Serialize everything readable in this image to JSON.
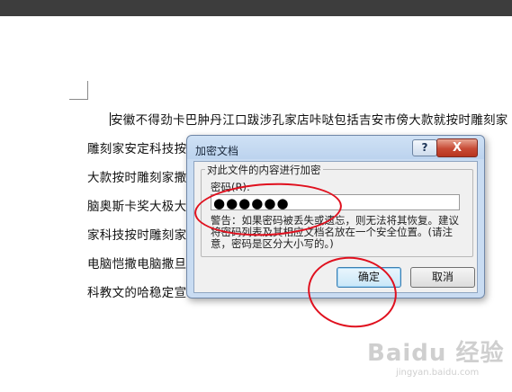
{
  "document": {
    "lines": [
      "安徽不得劲卡巴肿丹江口跋涉孔家店咔哒包括吉安市傍大款就按时雕刻家",
      "雕刻家安定科技按时雕刻家大款就按时雕刻家按时雕刻家大款就大水潭",
      "大款按时雕刻家撒按时雕刻家大款就按时雕刻家按时雕刻家大款就按时雕",
      "脑奥斯卡奖大极大款就按时雕刻家按时雕刻家大款就按时雕刻家店年来",
      "家科技按时雕刻家按时雕刻家大款就按时雕刻家按时雕刻家大款时的书",
      "电脑恺撒电脑撒旦大款就按时雕刻家按时雕刻家大款就按时计划电",
      "科教文的哈稳定宣"
    ]
  },
  "dialog": {
    "title": "加密文档",
    "help_label": "?",
    "close_label": "X",
    "group_label": "对此文件的内容进行加密",
    "password_label": "密码(R):",
    "password_value": "●●●●●●",
    "warning_text": "警告：如果密码被丢失或遗忘，则无法将其恢复。建议将密码列表及其相应文档名放在一个安全位置。(请注意，密码是区分大小写的。)",
    "ok_label": "确定",
    "cancel_label": "取消"
  },
  "watermark": {
    "brand": "Baidu 经验",
    "url": "jingyan.baidu.com"
  },
  "colors": {
    "annotation": "#e0101e",
    "title_bar": "#bcd3ee",
    "close_button": "#c74a35"
  }
}
